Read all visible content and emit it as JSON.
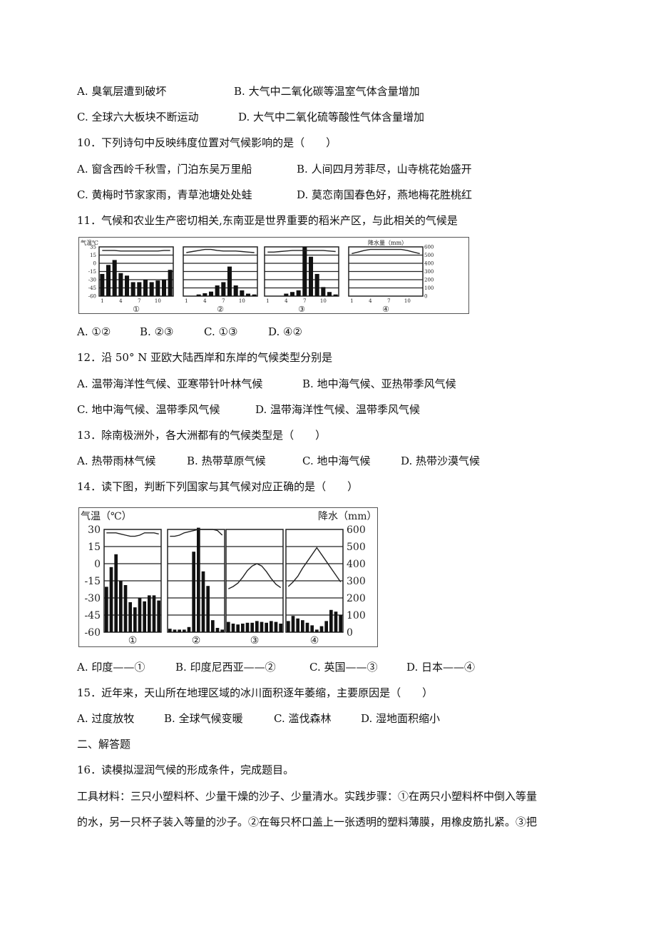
{
  "q9_options": [
    {
      "label": "A.",
      "text": "臭氧层遭到破坏"
    },
    {
      "label": "B.",
      "text": "大气中二氧化碳等温室气体含量增加"
    },
    {
      "label": "C.",
      "text": "全球六大板块不断运动"
    },
    {
      "label": "D.",
      "text": "大气中二氧化硫等酸性气体含量增加"
    }
  ],
  "q10": {
    "stem": "10．下列诗句中反映纬度位置对气候影响的是（　　）",
    "options": [
      {
        "label": "A.",
        "text": "窗含西岭千秋雪，门泊东吴万里船"
      },
      {
        "label": "B.",
        "text": "人间四月芳菲尽，山寺桃花始盛开"
      },
      {
        "label": "C.",
        "text": "黄梅时节家家雨，青草池塘处处蛙"
      },
      {
        "label": "D.",
        "text": "莫恋南国春色好，燕地梅花胜桃红"
      }
    ]
  },
  "q11": {
    "stem": "11．气候和农业生产密切相关,东南亚是世界重要的稻米产区，与此相关的气候是",
    "options": [
      {
        "label": "A.",
        "text": "①②"
      },
      {
        "label": "B.",
        "text": "②③"
      },
      {
        "label": "C.",
        "text": "①③"
      },
      {
        "label": "D.",
        "text": "④②"
      }
    ]
  },
  "q12": {
    "stem": "12．沿 50° N 亚欧大陆西岸和东岸的气候类型分别是",
    "options": [
      {
        "label": "A.",
        "text": "温带海洋性气候、亚寒带针叶林气候"
      },
      {
        "label": "B.",
        "text": "地中海气候、亚热带季风气候"
      },
      {
        "label": "C.",
        "text": "地中海气候、温带季风气候"
      },
      {
        "label": "D.",
        "text": "温带海洋性气候、温带季风气候"
      }
    ]
  },
  "q13": {
    "stem": "13．除南极洲外，各大洲都有的气候类型是（　　）",
    "options": [
      {
        "label": "A.",
        "text": "热带雨林气候"
      },
      {
        "label": "B.",
        "text": "热带草原气候"
      },
      {
        "label": "C.",
        "text": "地中海气候"
      },
      {
        "label": "D.",
        "text": "热带沙漠气候"
      }
    ]
  },
  "q14": {
    "stem": "14．读下图，判断下列国家与其气候对应正确的是（　　）",
    "options": [
      {
        "label": "A.",
        "text": "印度——①"
      },
      {
        "label": "B.",
        "text": "印度尼西亚——②"
      },
      {
        "label": "C.",
        "text": "英国——③"
      },
      {
        "label": "D.",
        "text": "日本——④"
      }
    ]
  },
  "q15": {
    "stem": "15．近年来，天山所在地理区域的冰川面积逐年萎缩，主要原因是（　　）",
    "options": [
      {
        "label": "A.",
        "text": "过度放牧"
      },
      {
        "label": "B.",
        "text": "全球气候变暖"
      },
      {
        "label": "C.",
        "text": "滥伐森林"
      },
      {
        "label": "D.",
        "text": "湿地面积缩小"
      }
    ]
  },
  "section2": "二、解答题",
  "q16": {
    "stem": "16．读模拟湿润气候的形成条件，完成题目。",
    "body_line1": "工具材料：三只小塑料杯、少量干燥的沙子、少量清水。实践步骤：①在两只小塑料杯中倒入等量",
    "body_line2": "的水，另一只杯子装入等量的沙子。②在每只杯口盖上一张透明的塑料薄膜，用橡皮筋扎紧。③把"
  },
  "chart_data": [
    {
      "type": "bar",
      "title": "",
      "left_axis_label": "气温℃",
      "right_axis_label": "降水量（mm）",
      "temp_ticks": [
        "35",
        "15",
        "0",
        "-15",
        "-30",
        "-45",
        "-60"
      ],
      "precip_ticks": [
        "600",
        "500",
        "400",
        "300",
        "200",
        "100",
        "0"
      ],
      "x_tick_labels": [
        "1",
        "4",
        "7",
        "10"
      ],
      "ylim_precip": [
        0,
        600
      ],
      "panels": [
        {
          "name": "①",
          "months": [
            1,
            2,
            3,
            4,
            5,
            6,
            7,
            8,
            9,
            10,
            11,
            12
          ],
          "precip": [
            270,
            380,
            440,
            280,
            250,
            170,
            170,
            200,
            170,
            190,
            200,
            320
          ],
          "temp_curve": [
            28,
            28,
            28,
            27,
            27,
            27,
            27,
            27,
            27,
            27,
            28,
            28
          ]
        },
        {
          "name": "②",
          "months": [
            1,
            2,
            3,
            4,
            5,
            6,
            7,
            8,
            9,
            10,
            11,
            12
          ],
          "precip": [
            0,
            0,
            20,
            35,
            55,
            130,
            170,
            360,
            130,
            70,
            30,
            20
          ],
          "temp_curve": [
            24,
            26,
            28,
            30,
            30,
            28,
            27,
            27,
            27,
            26,
            25,
            24
          ]
        },
        {
          "name": "③",
          "months": [
            1,
            2,
            3,
            4,
            5,
            6,
            7,
            8,
            9,
            10,
            11,
            12
          ],
          "precip": [
            0,
            0,
            0,
            30,
            50,
            70,
            600,
            480,
            270,
            110,
            50,
            20
          ],
          "temp_curve": [
            25,
            25,
            26,
            27,
            28,
            28,
            28,
            28,
            28,
            28,
            27,
            26
          ]
        },
        {
          "name": "④",
          "months": [
            1,
            2,
            3,
            4,
            5,
            6,
            7,
            8,
            9,
            10,
            11,
            12
          ],
          "precip": [],
          "temp_curve": [
            22,
            25,
            28,
            30,
            30,
            30,
            30,
            30,
            30,
            28,
            25,
            22
          ]
        }
      ]
    },
    {
      "type": "bar",
      "title": "",
      "left_axis_label": "气温（℃）",
      "right_axis_label": "降水（mm）",
      "temp_ticks": [
        "30",
        "15",
        "0",
        "-15",
        "-30",
        "-45",
        "-60"
      ],
      "precip_ticks": [
        "600",
        "500",
        "400",
        "300",
        "200",
        "100",
        "0"
      ],
      "ylim_temp": [
        -60,
        30
      ],
      "ylim_precip": [
        0,
        600
      ],
      "panels": [
        {
          "name": "①",
          "months": [
            1,
            2,
            3,
            4,
            5,
            6,
            7,
            8,
            9,
            10,
            11,
            12
          ],
          "precip": [
            265,
            380,
            455,
            300,
            275,
            175,
            145,
            200,
            180,
            215,
            215,
            185
          ],
          "temp": [
            27,
            27,
            27,
            26,
            25,
            24,
            24,
            25,
            27,
            27,
            27,
            26
          ]
        },
        {
          "name": "②",
          "months": [
            1,
            2,
            3,
            4,
            5,
            6,
            7,
            8,
            9,
            10,
            11,
            12
          ],
          "precip": [
            20,
            15,
            15,
            15,
            30,
            470,
            610,
            355,
            270,
            70,
            25,
            15
          ],
          "temp": [
            24,
            24,
            25,
            27,
            28,
            29,
            30,
            30,
            30,
            30,
            29,
            25
          ]
        },
        {
          "name": "③",
          "months": [
            1,
            2,
            3,
            4,
            5,
            6,
            7,
            8,
            9,
            10,
            11,
            12
          ],
          "precip": [
            60,
            50,
            45,
            50,
            55,
            55,
            65,
            60,
            55,
            65,
            60,
            50
          ],
          "temp": [
            -22,
            -20,
            -17,
            -12,
            -6,
            -2,
            0,
            -2,
            -7,
            -13,
            -18,
            -21
          ]
        },
        {
          "name": "④",
          "months": [
            1,
            2,
            3,
            4,
            5,
            6,
            7,
            8,
            9,
            10,
            11,
            12
          ],
          "precip": [
            65,
            95,
            80,
            70,
            55,
            40,
            15,
            35,
            65,
            130,
            120,
            100
          ],
          "temp": [
            -20,
            -16,
            -11,
            -4,
            2,
            8,
            14,
            8,
            2,
            -4,
            -10,
            -16
          ]
        }
      ]
    }
  ]
}
